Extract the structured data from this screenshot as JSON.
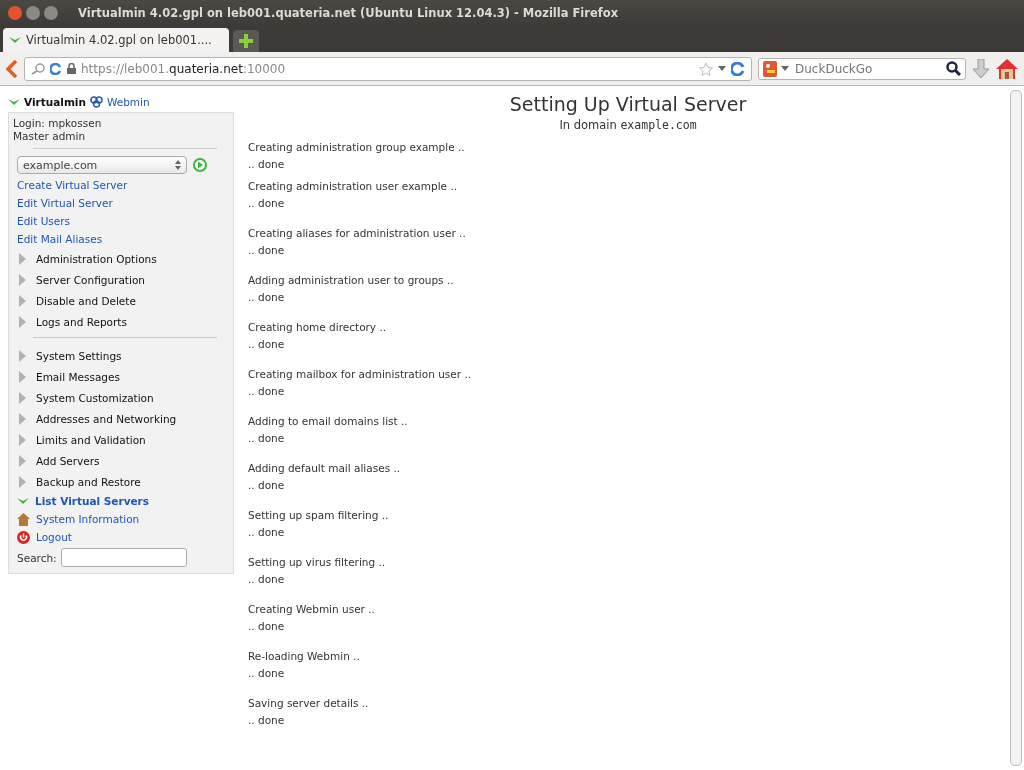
{
  "window": {
    "title": "Virtualmin 4.02.gpl on leb001.quateria.net (Ubuntu Linux 12.04.3) - Mozilla Firefox"
  },
  "tabs": [
    {
      "label": "Virtualmin 4.02.gpl on leb001....",
      "selected": true
    }
  ],
  "address_bar": {
    "scheme": "https://leb001.",
    "host": "quateria.net",
    "port": ":10000"
  },
  "search_bar": {
    "placeholder": "DuckDuckGo"
  },
  "sidebar": {
    "header": {
      "virtualmin": "Virtualmin",
      "webmin": "Webmin"
    },
    "login": "Login: mpkossen",
    "role": "Master admin",
    "domain_select": "example.com",
    "sections": [
      [
        {
          "kind": "link",
          "label": "Create Virtual Server"
        },
        {
          "kind": "link",
          "label": "Edit Virtual Server"
        },
        {
          "kind": "link",
          "label": "Edit Users"
        },
        {
          "kind": "link",
          "label": "Edit Mail Aliases"
        },
        {
          "kind": "category",
          "label": "Administration Options"
        },
        {
          "kind": "category",
          "label": "Server Configuration"
        },
        {
          "kind": "category",
          "label": "Disable and Delete"
        },
        {
          "kind": "category",
          "label": "Logs and Reports"
        }
      ],
      [
        {
          "kind": "category",
          "label": "System Settings"
        },
        {
          "kind": "category",
          "label": "Email Messages"
        },
        {
          "kind": "category",
          "label": "System Customization"
        },
        {
          "kind": "category",
          "label": "Addresses and Networking"
        },
        {
          "kind": "category",
          "label": "Limits and Validation"
        },
        {
          "kind": "category",
          "label": "Add Servers"
        },
        {
          "kind": "category",
          "label": "Backup and Restore"
        },
        {
          "kind": "open",
          "label": "List Virtual Servers"
        },
        {
          "kind": "home",
          "label": "System Information"
        },
        {
          "kind": "logout",
          "label": "Logout"
        }
      ]
    ],
    "search_label": "Search:"
  },
  "main": {
    "title": "Setting Up Virtual Server",
    "subtitle": "In domain",
    "domain": "example.com",
    "steps": [
      {
        "text": "Creating administration group example ..",
        "result": ".. done"
      },
      {
        "text": "Creating administration user example ..",
        "result": ".. done"
      },
      {
        "text": "Creating aliases for administration user ..",
        "result": ".. done"
      },
      {
        "text": "Adding administration user to groups ..",
        "result": ".. done"
      },
      {
        "text": "Creating home directory ..",
        "result": ".. done"
      },
      {
        "text": "Creating mailbox for administration user ..",
        "result": ".. done"
      },
      {
        "text": "Adding to email domains list ..",
        "result": ".. done"
      },
      {
        "text": "Adding default mail aliases ..",
        "result": ".. done"
      },
      {
        "text": "Setting up spam filtering ..",
        "result": ".. done"
      },
      {
        "text": "Setting up virus filtering ..",
        "result": ".. done"
      },
      {
        "text": "Creating Webmin user ..",
        "result": ".. done"
      },
      {
        "text": "Re-loading Webmin ..",
        "result": ".. done"
      },
      {
        "text": "Saving server details ..",
        "result": ".. done"
      }
    ]
  }
}
